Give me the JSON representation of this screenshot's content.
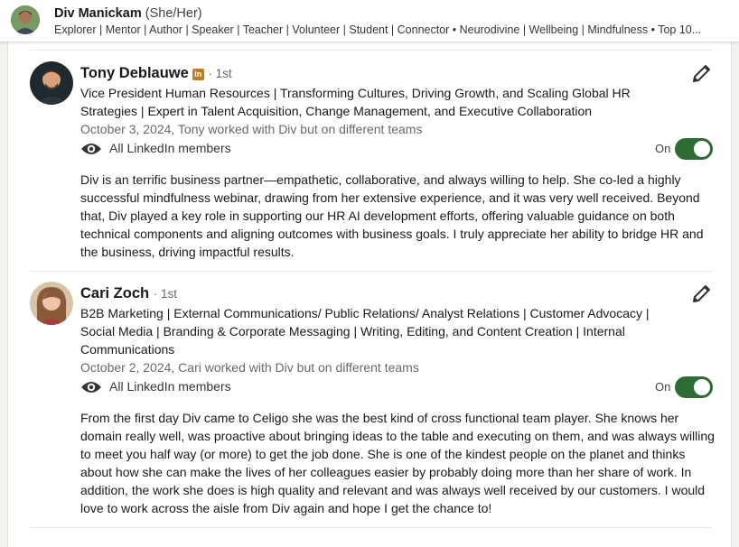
{
  "profile": {
    "name": "Div Manickam",
    "pronouns": "(She/Her)",
    "headline": "Explorer | Mentor | Author | Speaker | Teacher | Volunteer | Student | Connector • Neurodivine | Wellbeing | Mindfulness • Top 10..."
  },
  "recommendations": [
    {
      "name": "Tony Deblauwe",
      "badge": "in",
      "degree": "· 1st",
      "headline": "Vice President Human Resources | Transforming Cultures, Driving Growth, and Scaling Global HR Strategies | Expert in Talent Acquisition, Change Management, and Executive Collaboration",
      "date": "October 3, 2024, Tony worked with Div but on different teams",
      "visibility": "All LinkedIn members",
      "toggle_label": "On",
      "text": "Div is an terrific business partner—empathetic, collaborative, and always willing to help. She co-led a highly successful mindfulness webinar, drawing from her extensive experience, and it was very well received. Beyond that, Div played a key role in supporting our HR AI development efforts, offering valuable guidance on both technical components and aligning outcomes with business goals. I truly appreciate her ability to bridge HR and the business, driving impactful results."
    },
    {
      "name": "Cari Zoch",
      "degree": "· 1st",
      "headline": "B2B Marketing | External Communications/ Public Relations/ Analyst Relations | Customer Advocacy | Social Media | Branding & Corporate Messaging | Writing, Editing, and Content Creation | Internal Communications",
      "date": "October 2, 2024, Cari worked with Div but on different teams",
      "visibility": "All LinkedIn members",
      "toggle_label": "On",
      "text": "From the first day Div came to Celigo she was the best kind of cross functional team player. She knows her domain really well, was proactive about bringing ideas to the table and executing on them, and was always willing to meet you half way (or more) to get the job done. She is one of the kindest people on the planet and thinks about how she can make the lives of her colleagues easier by probably doing more than her share of work. In addition, the work she does is high quality and relevant and was always well received by our customers. I would love to work across the aisle from Div again and hope I get the chance to!"
    }
  ],
  "colors": {
    "toggle_on": "#2e6b35",
    "linkedin_badge": "#c37d16"
  }
}
